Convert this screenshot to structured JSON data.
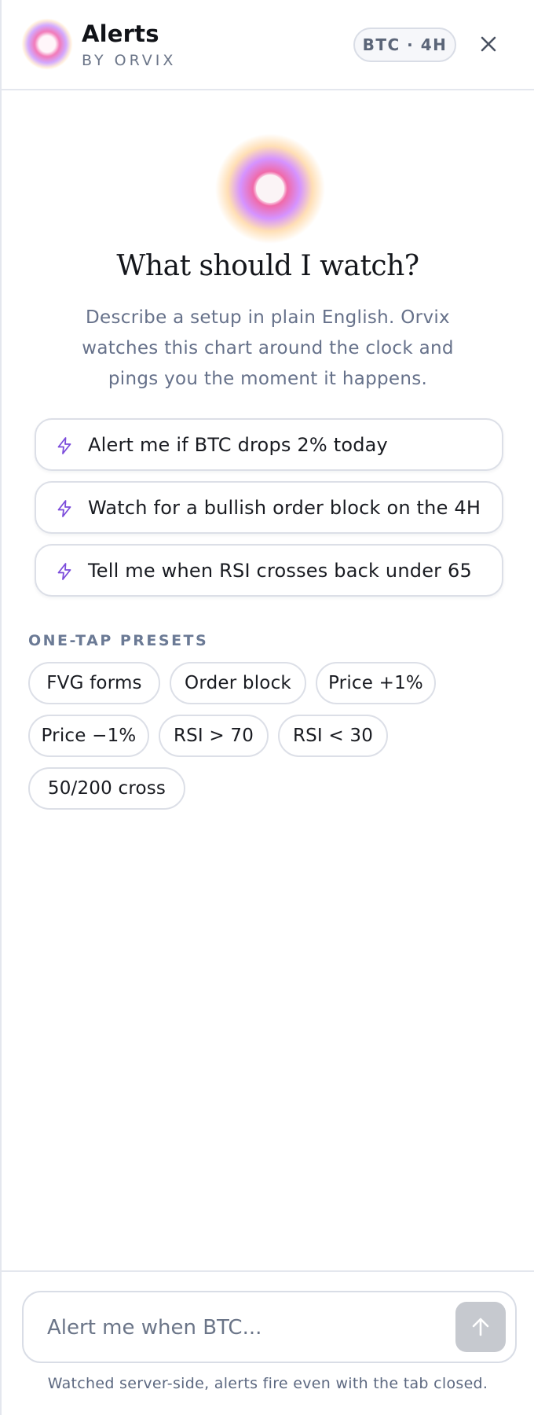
{
  "header": {
    "title": "Alerts",
    "subtitle": "BY ORVIX",
    "symbol_badge": "BTC · 4H",
    "close_icon": "close-icon",
    "logo_icon": "orb-logo-icon"
  },
  "hero": {
    "icon": "orb-icon",
    "title": "What should I watch?",
    "description": "Describe a setup in plain English. Orvix watches this chart around the clock and pings you the moment it happens."
  },
  "suggestions": [
    {
      "icon": "lightning-icon",
      "label": "Alert me if BTC drops 2% today"
    },
    {
      "icon": "lightning-icon",
      "label": "Watch for a bullish order block on the 4H"
    },
    {
      "icon": "lightning-icon",
      "label": "Tell me when RSI crosses back under 65"
    }
  ],
  "presets": {
    "label": "ONE-TAP PRESETS",
    "items": [
      "FVG forms",
      "Order block",
      "Price +1%",
      "Price −1%",
      "RSI > 70",
      "RSI < 30",
      "50/200 cross"
    ]
  },
  "composer": {
    "placeholder": "Alert me when BTC...",
    "value": "",
    "send_icon": "arrow-up-icon",
    "footnote": "Watched server-side, alerts fire even with the tab closed."
  },
  "colors": {
    "accent": "#7c4ddb",
    "border": "#dcdfe7",
    "muted_text": "#66718a",
    "send_disabled": "#c6c9cf"
  }
}
